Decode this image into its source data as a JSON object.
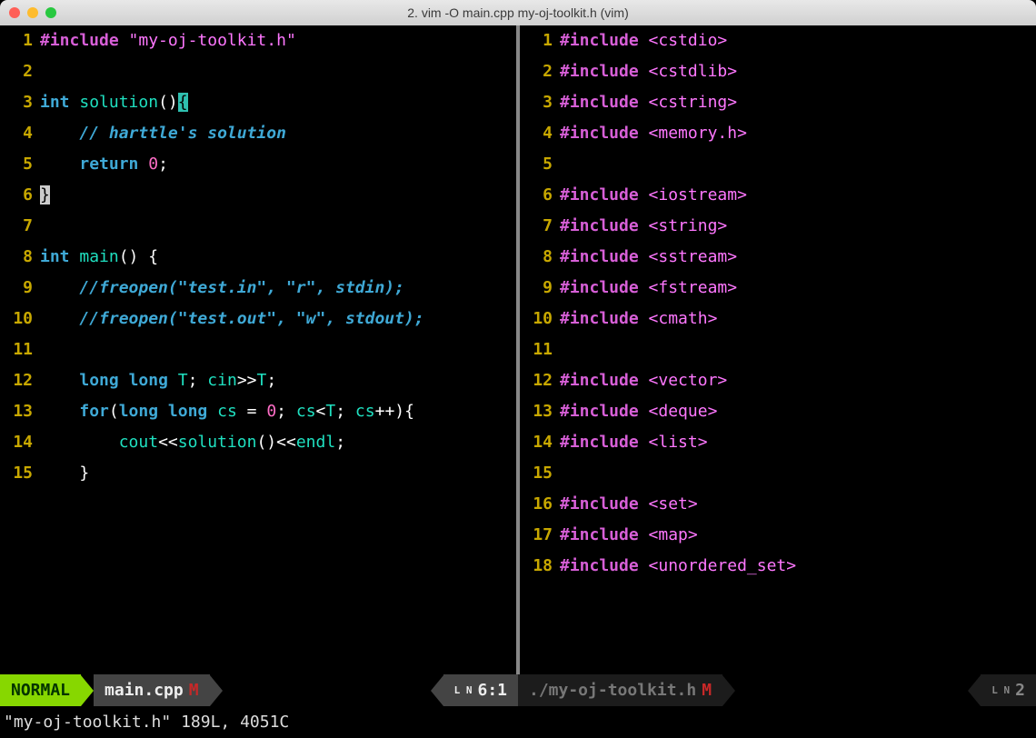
{
  "window": {
    "title": "2. vim -O main.cpp my-oj-toolkit.h (vim)"
  },
  "left_pane": {
    "lines": [
      {
        "n": "1",
        "tokens": [
          [
            "pp",
            "#include"
          ],
          [
            "op",
            " "
          ],
          [
            "str",
            "\"my-oj-toolkit.h\""
          ]
        ]
      },
      {
        "n": "2",
        "tokens": []
      },
      {
        "n": "3",
        "tokens": [
          [
            "kw",
            "int"
          ],
          [
            "op",
            " "
          ],
          [
            "fn",
            "solution"
          ],
          [
            "punct",
            "()"
          ],
          [
            "cursor",
            "{"
          ]
        ]
      },
      {
        "n": "4",
        "tokens": [
          [
            "op",
            "    "
          ],
          [
            "cmt",
            "// harttle's solution"
          ]
        ]
      },
      {
        "n": "5",
        "tokens": [
          [
            "op",
            "    "
          ],
          [
            "kw",
            "return"
          ],
          [
            "op",
            " "
          ],
          [
            "num",
            "0"
          ],
          [
            "punct",
            ";"
          ]
        ]
      },
      {
        "n": "6",
        "tokens": [
          [
            "hl",
            "}"
          ]
        ]
      },
      {
        "n": "7",
        "tokens": []
      },
      {
        "n": "8",
        "tokens": [
          [
            "kw",
            "int"
          ],
          [
            "op",
            " "
          ],
          [
            "fn",
            "main"
          ],
          [
            "punct",
            "() {"
          ]
        ]
      },
      {
        "n": "9",
        "tokens": [
          [
            "op",
            "    "
          ],
          [
            "cmt",
            "//freopen(\"test.in\", \"r\", stdin);"
          ]
        ]
      },
      {
        "n": "10",
        "tokens": [
          [
            "op",
            "    "
          ],
          [
            "cmt",
            "//freopen(\"test.out\", \"w\", stdout);"
          ]
        ]
      },
      {
        "n": "11",
        "tokens": []
      },
      {
        "n": "12",
        "tokens": [
          [
            "op",
            "    "
          ],
          [
            "kw",
            "long"
          ],
          [
            "op",
            " "
          ],
          [
            "kw",
            "long"
          ],
          [
            "op",
            " "
          ],
          [
            "id",
            "T"
          ],
          [
            "punct",
            "; "
          ],
          [
            "id",
            "cin"
          ],
          [
            "op",
            ">>"
          ],
          [
            "id",
            "T"
          ],
          [
            "punct",
            ";"
          ]
        ]
      },
      {
        "n": "13",
        "tokens": [
          [
            "op",
            "    "
          ],
          [
            "kw",
            "for"
          ],
          [
            "punct",
            "("
          ],
          [
            "kw",
            "long"
          ],
          [
            "op",
            " "
          ],
          [
            "kw",
            "long"
          ],
          [
            "op",
            " "
          ],
          [
            "id",
            "cs"
          ],
          [
            "op",
            " = "
          ],
          [
            "num",
            "0"
          ],
          [
            "punct",
            "; "
          ],
          [
            "id",
            "cs"
          ],
          [
            "op",
            "<"
          ],
          [
            "id",
            "T"
          ],
          [
            "punct",
            "; "
          ],
          [
            "id",
            "cs"
          ],
          [
            "op",
            "++"
          ],
          [
            "punct",
            "){"
          ]
        ]
      },
      {
        "n": "14",
        "tokens": [
          [
            "op",
            "        "
          ],
          [
            "id",
            "cout"
          ],
          [
            "op",
            "<<"
          ],
          [
            "fn",
            "solution"
          ],
          [
            "punct",
            "()"
          ],
          [
            "op",
            "<<"
          ],
          [
            "id",
            "endl"
          ],
          [
            "punct",
            ";"
          ]
        ]
      },
      {
        "n": "15",
        "tokens": [
          [
            "op",
            "    "
          ],
          [
            "punct",
            "}"
          ]
        ]
      }
    ]
  },
  "right_pane": {
    "lines": [
      {
        "n": "1",
        "tokens": [
          [
            "pp",
            "#include"
          ],
          [
            "op",
            " "
          ],
          [
            "str",
            "<cstdio>"
          ]
        ]
      },
      {
        "n": "2",
        "tokens": [
          [
            "pp",
            "#include"
          ],
          [
            "op",
            " "
          ],
          [
            "str",
            "<cstdlib>"
          ]
        ]
      },
      {
        "n": "3",
        "tokens": [
          [
            "pp",
            "#include"
          ],
          [
            "op",
            " "
          ],
          [
            "str",
            "<cstring>"
          ]
        ]
      },
      {
        "n": "4",
        "tokens": [
          [
            "pp",
            "#include"
          ],
          [
            "op",
            " "
          ],
          [
            "str",
            "<memory.h>"
          ]
        ]
      },
      {
        "n": "5",
        "tokens": []
      },
      {
        "n": "6",
        "tokens": [
          [
            "pp",
            "#include"
          ],
          [
            "op",
            " "
          ],
          [
            "str",
            "<iostream>"
          ]
        ]
      },
      {
        "n": "7",
        "tokens": [
          [
            "pp",
            "#include"
          ],
          [
            "op",
            " "
          ],
          [
            "str",
            "<string>"
          ]
        ]
      },
      {
        "n": "8",
        "tokens": [
          [
            "pp",
            "#include"
          ],
          [
            "op",
            " "
          ],
          [
            "str",
            "<sstream>"
          ]
        ]
      },
      {
        "n": "9",
        "tokens": [
          [
            "pp",
            "#include"
          ],
          [
            "op",
            " "
          ],
          [
            "str",
            "<fstream>"
          ]
        ]
      },
      {
        "n": "10",
        "tokens": [
          [
            "pp",
            "#include"
          ],
          [
            "op",
            " "
          ],
          [
            "str",
            "<cmath>"
          ]
        ]
      },
      {
        "n": "11",
        "tokens": []
      },
      {
        "n": "12",
        "tokens": [
          [
            "pp",
            "#include"
          ],
          [
            "op",
            " "
          ],
          [
            "str",
            "<vector>"
          ]
        ]
      },
      {
        "n": "13",
        "tokens": [
          [
            "pp",
            "#include"
          ],
          [
            "op",
            " "
          ],
          [
            "str",
            "<deque>"
          ]
        ]
      },
      {
        "n": "14",
        "tokens": [
          [
            "pp",
            "#include"
          ],
          [
            "op",
            " "
          ],
          [
            "str",
            "<list>"
          ]
        ]
      },
      {
        "n": "15",
        "tokens": []
      },
      {
        "n": "16",
        "tokens": [
          [
            "pp",
            "#include"
          ],
          [
            "op",
            " "
          ],
          [
            "str",
            "<set>"
          ]
        ]
      },
      {
        "n": "17",
        "tokens": [
          [
            "pp",
            "#include"
          ],
          [
            "op",
            " "
          ],
          [
            "str",
            "<map>"
          ]
        ]
      },
      {
        "n": "18",
        "tokens": [
          [
            "pp",
            "#include"
          ],
          [
            "op",
            " "
          ],
          [
            "str",
            "<unordered_set>"
          ]
        ]
      }
    ]
  },
  "status": {
    "mode": "NORMAL",
    "left_file": "main.cpp",
    "left_modified": "M",
    "left_pos": "6:1",
    "right_file": "./my-oj-toolkit.h",
    "right_modified": "M",
    "right_pos": "2",
    "ln_symbol": "L\nN"
  },
  "cmdline": "\"my-oj-toolkit.h\" 189L, 4051C"
}
